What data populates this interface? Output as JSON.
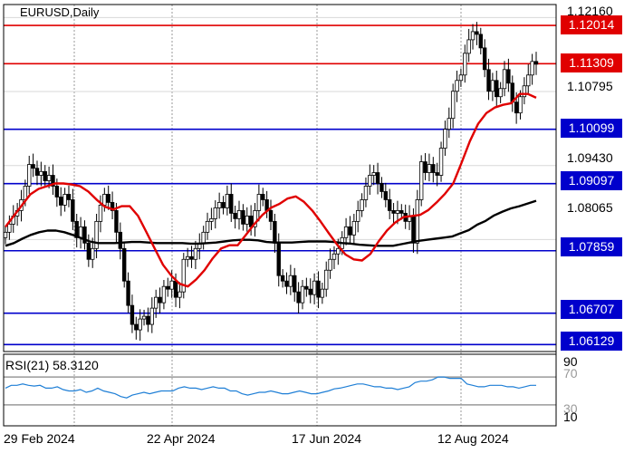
{
  "main_chart": {
    "title": "EURUSD,Daily",
    "price_axis": [
      {
        "label": "1.12160",
        "value": 1.1216
      },
      {
        "label": "1.10795",
        "value": 1.10795
      },
      {
        "label": "1.09430",
        "value": 1.0943
      },
      {
        "label": "1.08065",
        "value": 1.08065
      }
    ],
    "levels": [
      {
        "label": "1.12014",
        "value": 1.12014,
        "color": "#e00000"
      },
      {
        "label": "1.11309",
        "value": 1.11309,
        "color": "#e00000"
      },
      {
        "label": "1.10099",
        "value": 1.10099,
        "color": "#0000cc"
      },
      {
        "label": "1.09097",
        "value": 1.09097,
        "color": "#0000cc"
      },
      {
        "label": "1.07859",
        "value": 1.07859,
        "color": "#0000cc"
      },
      {
        "label": "1.06707",
        "value": 1.06707,
        "color": "#0000cc"
      },
      {
        "label": "1.06129",
        "value": 1.06129,
        "color": "#0000cc"
      }
    ]
  },
  "rsi_panel": {
    "title": "RSI(21) 58.3120",
    "axis": [
      {
        "label": "90",
        "value": 90
      },
      {
        "label": "70",
        "value": 70
      },
      {
        "label": "30",
        "value": 30
      },
      {
        "label": "10",
        "value": 10
      }
    ]
  },
  "time_axis": [
    "29 Feb 2024",
    "22 Apr 2024",
    "17 Jun 2024",
    "12 Aug 2024"
  ],
  "chart_data": {
    "type": "candlestick",
    "symbol": "EURUSD",
    "timeframe": "Daily",
    "y_range": [
      1.06,
      1.124
    ],
    "x_labels": [
      "29 Feb 2024",
      "22 Apr 2024",
      "17 Jun 2024",
      "12 Aug 2024"
    ],
    "price_close": [
      1.082,
      1.0835,
      1.085,
      1.086,
      1.088,
      1.0905,
      1.0945,
      1.0938,
      1.0925,
      1.0932,
      1.0915,
      1.0925,
      1.0905,
      1.0885,
      1.087,
      1.089,
      1.088,
      1.084,
      1.081,
      1.083,
      1.08,
      1.077,
      1.079,
      1.084,
      1.087,
      1.089,
      1.0875,
      1.086,
      1.082,
      1.079,
      1.073,
      1.0685,
      1.065,
      1.064,
      1.066,
      1.0665,
      1.065,
      1.068,
      1.07,
      1.069,
      1.072,
      1.0715,
      1.073,
      1.07,
      1.071,
      1.077,
      1.0775,
      1.077,
      1.079,
      1.08,
      1.082,
      1.084,
      1.0845,
      1.0865,
      1.0875,
      1.0865,
      1.089,
      1.0855,
      1.0845,
      1.086,
      1.0835,
      1.085,
      1.083,
      1.086,
      1.089,
      1.088,
      1.086,
      1.084,
      1.08,
      1.074,
      1.073,
      1.072,
      1.074,
      1.071,
      1.069,
      1.072,
      1.0715,
      1.0705,
      1.073,
      1.07,
      1.0715,
      1.075,
      1.077,
      1.078,
      1.079,
      1.081,
      1.083,
      1.0815,
      1.084,
      1.086,
      1.088,
      1.0905,
      1.0925,
      1.093,
      1.091,
      1.0895,
      1.088,
      1.086,
      1.0855,
      1.086,
      1.0855,
      1.084,
      1.085,
      1.08,
      1.088,
      1.095,
      1.093,
      1.0945,
      1.093,
      1.0925,
      1.0975,
      1.101,
      1.103,
      1.108,
      1.11,
      1.111,
      1.115,
      1.1175,
      1.119,
      1.1185,
      1.116,
      1.112,
      1.108,
      1.11,
      1.107,
      1.1085,
      1.112,
      1.1095,
      1.106,
      1.104,
      1.107,
      1.109,
      1.111,
      1.1135,
      1.113
    ],
    "ma_short": [
      1.083,
      1.085,
      1.087,
      1.089,
      1.09,
      1.0905,
      1.091,
      1.091,
      1.0908,
      1.0905,
      1.0895,
      1.088,
      1.0867,
      1.0862,
      1.0868,
      1.0868,
      1.085,
      1.082,
      1.079,
      1.076,
      1.074,
      1.0725,
      1.072,
      1.0733,
      1.075,
      1.0772,
      1.079,
      1.0796,
      1.0796,
      1.0815,
      1.0835,
      1.0852,
      1.0865,
      1.0872,
      1.0882,
      1.0886,
      1.0876,
      1.086,
      1.084,
      1.0818,
      1.0797,
      1.0779,
      1.077,
      1.0768,
      1.078,
      1.0803,
      1.0823,
      1.0838,
      1.0848,
      1.085,
      1.0852,
      1.0861,
      1.0875,
      1.0891,
      1.091,
      1.0948,
      1.0988,
      1.102,
      1.104,
      1.105,
      1.1055,
      1.1058,
      1.1075,
      1.1075,
      1.1068
    ],
    "ma_long": [
      1.0795,
      1.08,
      1.0808,
      1.0815,
      1.082,
      1.0823,
      1.0823,
      1.082,
      1.0815,
      1.0809,
      1.0803,
      1.08,
      1.08,
      1.08,
      1.0801,
      1.0802,
      1.0802,
      1.0801,
      1.08,
      1.08,
      1.08,
      1.08,
      1.0799,
      1.0799,
      1.08,
      1.0801,
      1.0803,
      1.0805,
      1.0806,
      1.0806,
      1.0805,
      1.0802,
      1.0801,
      1.0801,
      1.0801,
      1.0802,
      1.0803,
      1.0803,
      1.0803,
      1.0802,
      1.08,
      1.0799,
      1.0797,
      1.0796,
      1.0795,
      1.0795,
      1.0795,
      1.0798,
      1.0801,
      1.0804,
      1.0806,
      1.0808,
      1.081,
      1.0812,
      1.0818,
      1.0824,
      1.0834,
      1.0841,
      1.0851,
      1.0858,
      1.0864,
      1.0868,
      1.0873,
      1.0878
    ],
    "rsi": [
      54,
      58,
      58,
      60,
      58,
      57,
      58,
      54,
      54,
      56,
      52,
      50,
      50,
      52,
      48,
      50,
      54,
      50,
      48,
      46,
      42,
      40,
      44,
      46,
      48,
      46,
      48,
      50,
      50,
      50,
      54,
      56,
      54,
      54,
      52,
      54,
      56,
      54,
      54,
      50,
      50,
      46,
      44,
      46,
      48,
      48,
      50,
      48,
      46,
      46,
      48,
      50,
      48,
      46,
      46,
      48,
      50,
      53,
      54,
      56,
      58,
      60,
      60,
      58,
      56,
      56,
      54,
      54,
      52,
      54,
      56,
      62,
      64,
      64,
      66,
      70,
      70,
      68,
      68,
      68,
      60,
      58,
      56,
      56,
      58,
      58,
      58,
      56,
      56,
      54,
      56,
      58,
      58
    ],
    "rsi_current": 58.312,
    "series": [
      {
        "name": "EURUSD"
      },
      {
        "name": "RSI(21)"
      }
    ],
    "colors": {
      "ma_short": "#e00000",
      "ma_long": "#000000",
      "rsi": "#1f7fd6",
      "bull_body": "#ffffff",
      "bear_body": "#000000"
    }
  }
}
